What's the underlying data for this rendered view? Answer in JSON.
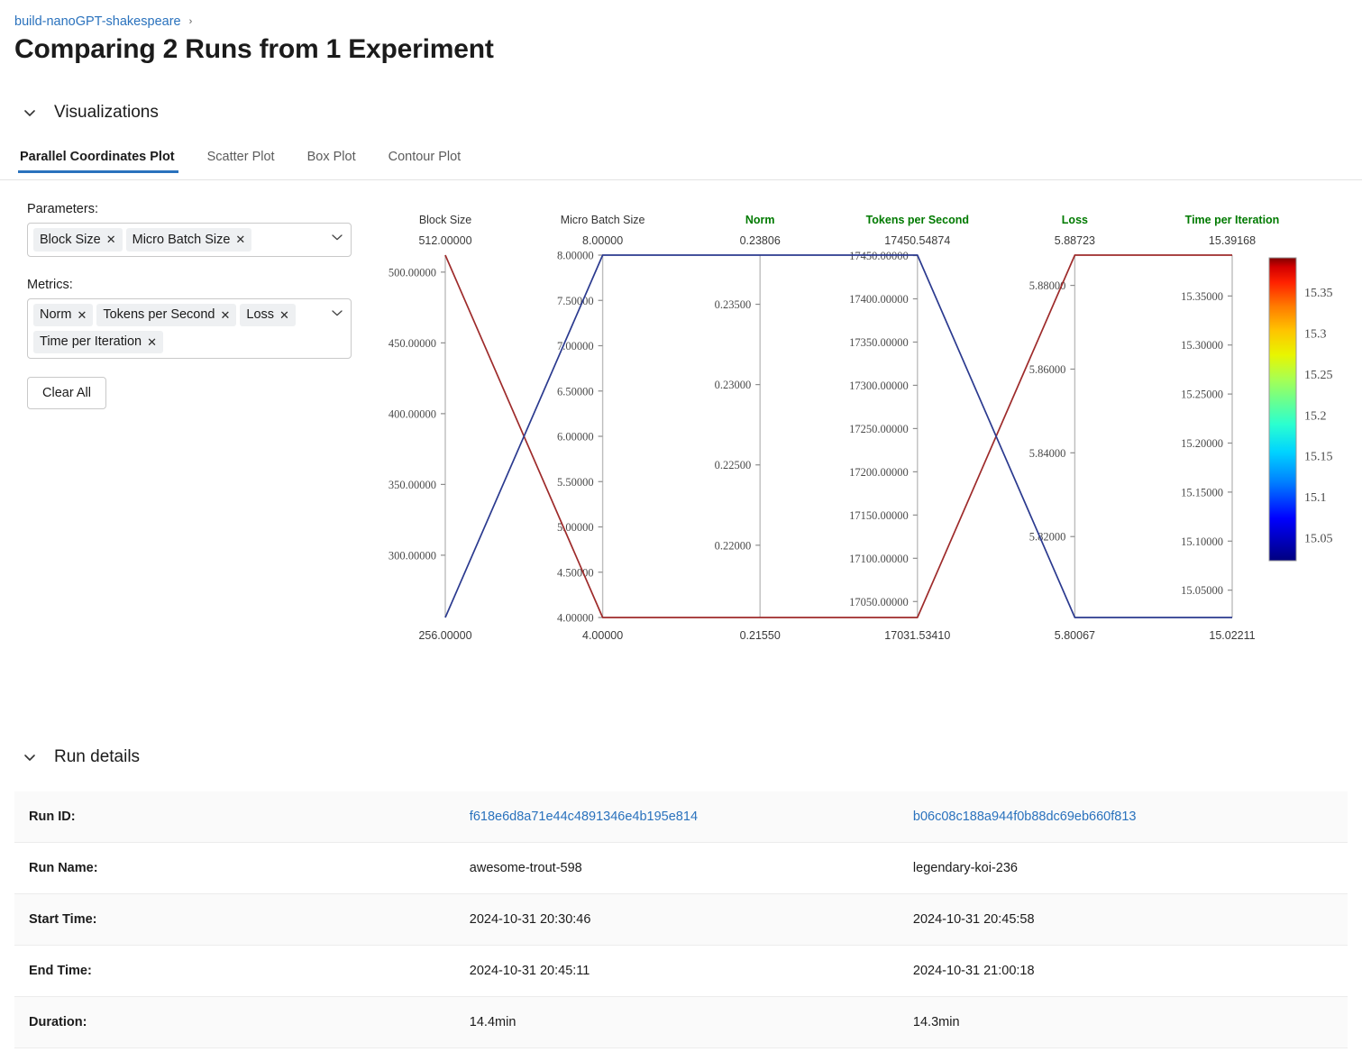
{
  "breadcrumb": {
    "experiment": "build-nanoGPT-shakespeare",
    "separator": "›"
  },
  "page_title": "Comparing 2 Runs from 1 Experiment",
  "sections": {
    "visualizations": {
      "label": "Visualizations",
      "expanded": true
    },
    "run_details": {
      "label": "Run details",
      "expanded": true
    }
  },
  "tabs": [
    {
      "label": "Parallel Coordinates Plot",
      "active": true
    },
    {
      "label": "Scatter Plot",
      "active": false
    },
    {
      "label": "Box Plot",
      "active": false
    },
    {
      "label": "Contour Plot",
      "active": false
    }
  ],
  "controls": {
    "parameters_label": "Parameters:",
    "parameters": [
      "Block Size",
      "Micro Batch Size"
    ],
    "metrics_label": "Metrics:",
    "metrics": [
      "Norm",
      "Tokens per Second",
      "Loss",
      "Time per Iteration"
    ],
    "clear_all_label": "Clear All",
    "remove_glyph": "✕"
  },
  "chart_data": {
    "type": "line",
    "title": "",
    "subtype": "parallel-coordinates",
    "colorscale": "jet",
    "color_by": "Time per Iteration",
    "colorbar": {
      "ticks": [
        "15.35",
        "15.3",
        "15.25",
        "15.2",
        "15.15",
        "15.1",
        "15.05"
      ],
      "min": 15.02211,
      "max": 15.39168
    },
    "axes": [
      {
        "name": "Block Size",
        "kind": "parameter",
        "top_value": "512.00000",
        "bottom_value": "256.00000",
        "min": 256,
        "max": 512,
        "ticks": [
          "500.00000",
          "450.00000",
          "400.00000",
          "350.00000",
          "300.00000"
        ],
        "tick_values": [
          500,
          450,
          400,
          350,
          300
        ]
      },
      {
        "name": "Micro Batch Size",
        "kind": "parameter",
        "top_value": "8.00000",
        "bottom_value": "4.00000",
        "min": 4,
        "max": 8,
        "ticks": [
          "8.00000",
          "7.50000",
          "7.00000",
          "6.50000",
          "6.00000",
          "5.50000",
          "5.00000",
          "4.50000",
          "4.00000"
        ],
        "tick_values": [
          8,
          7.5,
          7,
          6.5,
          6,
          5.5,
          5,
          4.5,
          4
        ]
      },
      {
        "name": "Norm",
        "kind": "metric",
        "top_value": "0.23806",
        "bottom_value": "0.21550",
        "min": 0.2155,
        "max": 0.23806,
        "ticks": [
          "0.23500",
          "0.23000",
          "0.22500",
          "0.22000"
        ],
        "tick_values": [
          0.235,
          0.23,
          0.225,
          0.22
        ]
      },
      {
        "name": "Tokens per Second",
        "kind": "metric",
        "top_value": "17450.54874",
        "bottom_value": "17031.53410",
        "min": 17031.5341,
        "max": 17450.54874,
        "ticks": [
          "17450.00000",
          "17400.00000",
          "17350.00000",
          "17300.00000",
          "17250.00000",
          "17200.00000",
          "17150.00000",
          "17100.00000",
          "17050.00000"
        ],
        "tick_values": [
          17450,
          17400,
          17350,
          17300,
          17250,
          17200,
          17150,
          17100,
          17050
        ]
      },
      {
        "name": "Loss",
        "kind": "metric",
        "top_value": "5.88723",
        "bottom_value": "5.80067",
        "min": 5.80067,
        "max": 5.88723,
        "ticks": [
          "5.88000",
          "5.86000",
          "5.84000",
          "5.82000"
        ],
        "tick_values": [
          5.88,
          5.86,
          5.84,
          5.82
        ]
      },
      {
        "name": "Time per Iteration",
        "kind": "metric",
        "top_value": "15.39168",
        "bottom_value": "15.02211",
        "min": 15.02211,
        "max": 15.39168,
        "ticks": [
          "15.35000",
          "15.30000",
          "15.25000",
          "15.20000",
          "15.15000",
          "15.10000",
          "15.05000"
        ],
        "tick_values": [
          15.35,
          15.3,
          15.25,
          15.2,
          15.15,
          15.1,
          15.05
        ]
      }
    ],
    "series": [
      {
        "name": "awesome-trout-598",
        "color": "#9E2B2B",
        "values": [
          512.0,
          4.0,
          0.2155,
          17031.5341,
          5.88723,
          15.39168
        ]
      },
      {
        "name": "legendary-koi-236",
        "color": "#2B3A8F",
        "values": [
          256.0,
          8.0,
          0.23806,
          17450.54874,
          5.80067,
          15.02211
        ]
      }
    ]
  },
  "run_details": {
    "rows": [
      {
        "label": "Run ID:",
        "values": [
          "f618e6d8a71e44c4891346e4b195e814",
          "b06c08c188a944f0b88dc69eb660f813"
        ],
        "is_link": true
      },
      {
        "label": "Run Name:",
        "values": [
          "awesome-trout-598",
          "legendary-koi-236"
        ],
        "is_link": false
      },
      {
        "label": "Start Time:",
        "values": [
          "2024-10-31 20:30:46",
          "2024-10-31 20:45:58"
        ],
        "is_link": false
      },
      {
        "label": "End Time:",
        "values": [
          "2024-10-31 20:45:11",
          "2024-10-31 21:00:18"
        ],
        "is_link": false
      },
      {
        "label": "Duration:",
        "values": [
          "14.4min",
          "14.3min"
        ],
        "is_link": false
      }
    ]
  }
}
